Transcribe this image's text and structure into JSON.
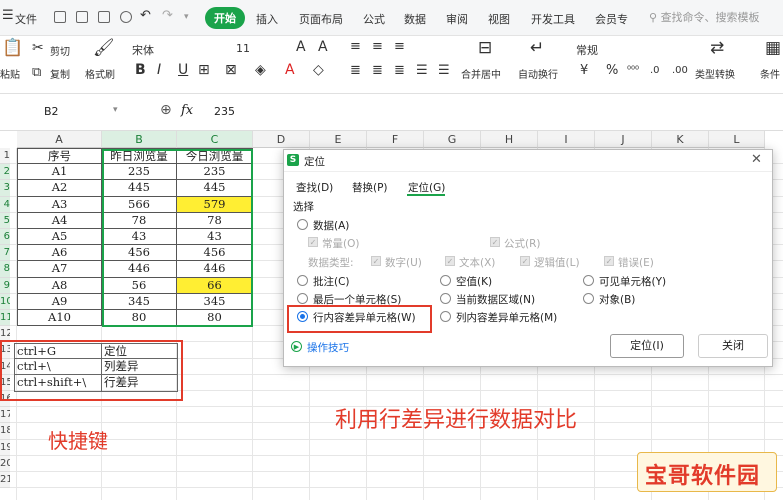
{
  "menubar": {
    "items": [
      "文件",
      "开始",
      "插入",
      "页面布局",
      "公式",
      "数据",
      "审阅",
      "视图",
      "开发工具",
      "会员专"
    ],
    "search_placeholder": "查找命令、搜索模板"
  },
  "ribbon": {
    "paste": "粘贴",
    "cut": "剪切",
    "copy": "复制",
    "format_painter": "格式刷",
    "font_name": "宋体",
    "font_size": "11",
    "bold": "B",
    "italic": "I",
    "underline": "U",
    "merge_center": "合并居中",
    "wrap_text": "自动换行",
    "number_format": "常规",
    "currency": "¥",
    "percent": "%",
    "type_convert": "类型转换",
    "conditional": "条件"
  },
  "formula_bar": {
    "cell_ref": "B2",
    "fx": "fx",
    "value": "235"
  },
  "sheet": {
    "columns": [
      "A",
      "B",
      "C",
      "D",
      "E",
      "F",
      "G",
      "H",
      "I",
      "J",
      "K",
      "L"
    ],
    "rows": [
      "1",
      "2",
      "3",
      "4",
      "5",
      "6",
      "7",
      "8",
      "9",
      "10",
      "11",
      "12",
      "13",
      "14",
      "15",
      "16",
      "17",
      "18",
      "19",
      "20",
      "21"
    ],
    "header": [
      "序号",
      "昨日浏览量",
      "今日浏览量"
    ],
    "data": [
      [
        "A1",
        "235",
        "235"
      ],
      [
        "A2",
        "445",
        "445"
      ],
      [
        "A3",
        "566",
        "579"
      ],
      [
        "A4",
        "78",
        "78"
      ],
      [
        "A5",
        "43",
        "43"
      ],
      [
        "A6",
        "456",
        "456"
      ],
      [
        "A7",
        "446",
        "446"
      ],
      [
        "A8",
        "56",
        "66"
      ],
      [
        "A9",
        "345",
        "345"
      ],
      [
        "A10",
        "80",
        "80"
      ]
    ],
    "shortcuts": [
      [
        "ctrl+G",
        "定位"
      ],
      [
        "ctrl+\\",
        "列差异"
      ],
      [
        "ctrl+shift+\\",
        "行差异"
      ]
    ],
    "highlight_color": "#ffee33"
  },
  "dialog": {
    "title": "定位",
    "tabs": [
      "查找(D)",
      "替换(P)",
      "定位(G)"
    ],
    "section": "选择",
    "data_label": "数据(A)",
    "constant": "常量(O)",
    "formula": "公式(R)",
    "data_type": "数据类型:",
    "number": "数字(U)",
    "text": "文本(X)",
    "logical": "逻辑值(L)",
    "error": "错误(E)",
    "comment": "批注(C)",
    "blank": "空值(K)",
    "visible_cells": "可见单元格(Y)",
    "last_cell": "最后一个单元格(S)",
    "current_region": "当前数据区域(N)",
    "object": "对象(B)",
    "row_diff": "行内容差异单元格(W)",
    "col_diff": "列内容差异单元格(M)",
    "tips": "操作技巧",
    "ok": "定位(I)",
    "close": "关闭"
  },
  "annotations": {
    "shortcut_label": "快捷键",
    "caption": "利用行差异进行数据对比",
    "watermark": "宝哥软件园"
  },
  "colors": {
    "accent": "#1aa34a",
    "annotation_red": "#e23b2a",
    "radio_blue": "#1a73e8"
  }
}
